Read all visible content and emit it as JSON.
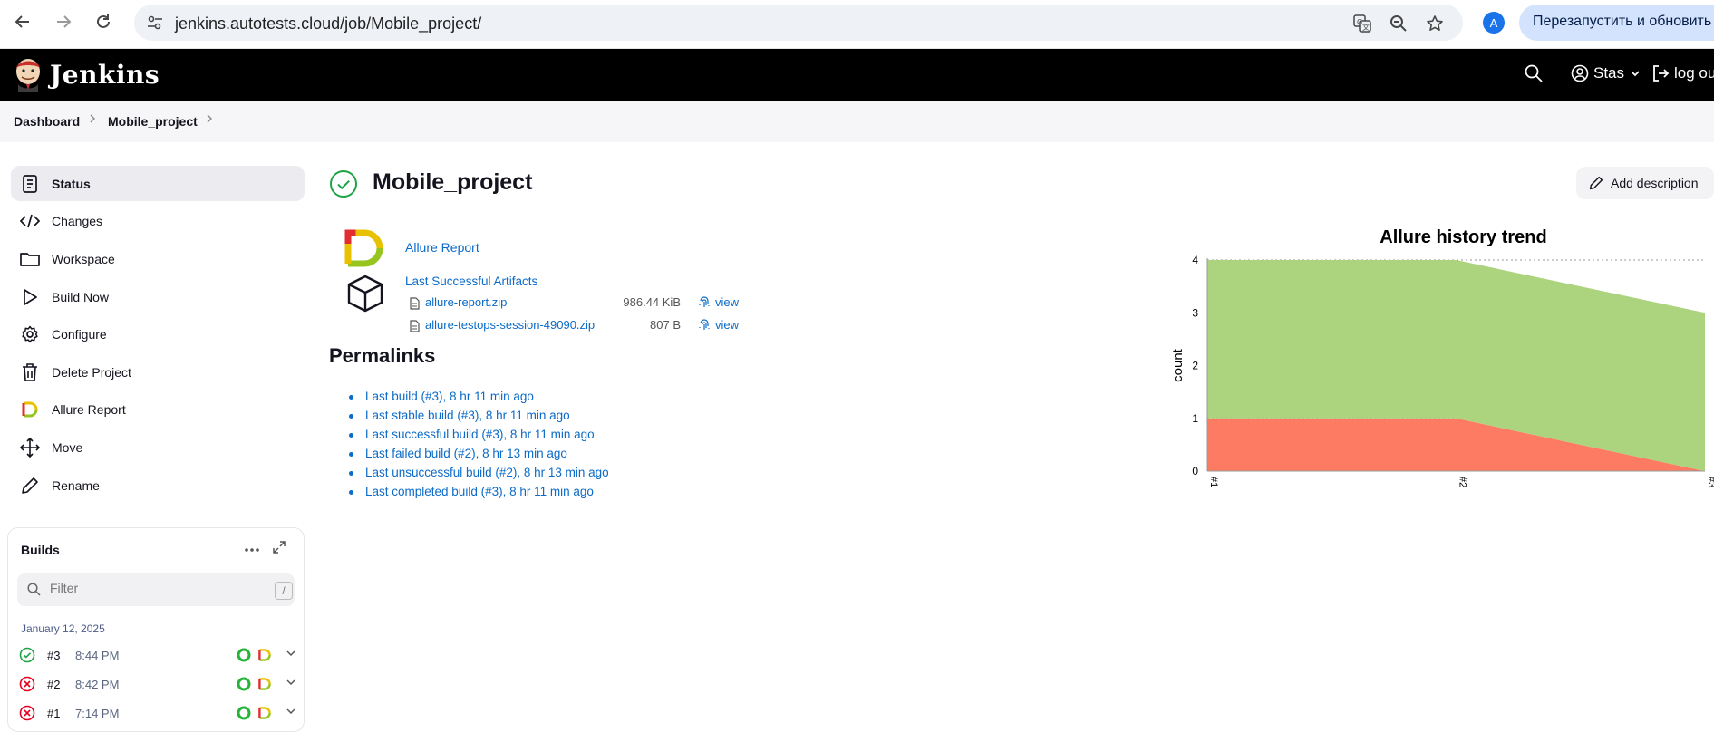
{
  "browser": {
    "url": "jenkins.autotests.cloud/job/Mobile_project/",
    "profile_initial": "A",
    "relaunch_label": "Перезапустить и обновить"
  },
  "header": {
    "app_name": "Jenkins",
    "user": "Stas",
    "logout_label": "log out"
  },
  "breadcrumb": [
    "Dashboard",
    "Mobile_project"
  ],
  "sidebar": {
    "items": [
      {
        "label": "Status",
        "icon": "status-icon"
      },
      {
        "label": "Changes",
        "icon": "code-icon"
      },
      {
        "label": "Workspace",
        "icon": "folder-icon"
      },
      {
        "label": "Build Now",
        "icon": "play-icon"
      },
      {
        "label": "Configure",
        "icon": "gear-icon"
      },
      {
        "label": "Delete Project",
        "icon": "trash-icon"
      },
      {
        "label": "Allure Report",
        "icon": "allure-icon"
      },
      {
        "label": "Move",
        "icon": "move-icon"
      },
      {
        "label": "Rename",
        "icon": "pencil-icon"
      }
    ]
  },
  "builds": {
    "title": "Builds",
    "filter_placeholder": "Filter",
    "filter_shortcut": "/",
    "date": "January 12, 2025",
    "rows": [
      {
        "number": "#3",
        "time": "8:44 PM",
        "status": "success"
      },
      {
        "number": "#2",
        "time": "8:42 PM",
        "status": "failed"
      },
      {
        "number": "#1",
        "time": "7:14 PM",
        "status": "failed"
      }
    ]
  },
  "main": {
    "title": "Mobile_project",
    "add_description": "Add description",
    "allure_report_link": "Allure Report",
    "artifacts_title": "Last Successful Artifacts",
    "artifacts": [
      {
        "name": "allure-report.zip",
        "size": "986.44 KiB",
        "view": "view"
      },
      {
        "name": "allure-testops-session-49090.zip",
        "size": "807 B",
        "view": "view"
      }
    ],
    "permalinks_title": "Permalinks",
    "permalinks": [
      "Last build (#3), 8 hr 11 min ago",
      "Last stable build (#3), 8 hr 11 min ago",
      "Last successful build (#3), 8 hr 11 min ago",
      "Last failed build (#2), 8 hr 13 min ago",
      "Last unsuccessful build (#2), 8 hr 13 min ago",
      "Last completed build (#3), 8 hr 11 min ago"
    ]
  },
  "chart_data": {
    "type": "area",
    "title": "Allure history trend",
    "ylabel": "count",
    "categories": [
      "#1",
      "#2",
      "#3"
    ],
    "ylim": [
      0,
      4
    ],
    "yticks": [
      "0",
      "1",
      "2",
      "3",
      "4"
    ],
    "series": [
      {
        "color": "#fd7b63",
        "values": [
          1,
          1,
          0
        ]
      },
      {
        "color": "#acd47e",
        "values": [
          3,
          3,
          3
        ]
      }
    ]
  },
  "colors": {
    "link": "#0b6bc8",
    "success": "#1ea446",
    "failed": "#e6001f",
    "failed_area": "#fd7b63",
    "passed_area": "#acd47e"
  }
}
